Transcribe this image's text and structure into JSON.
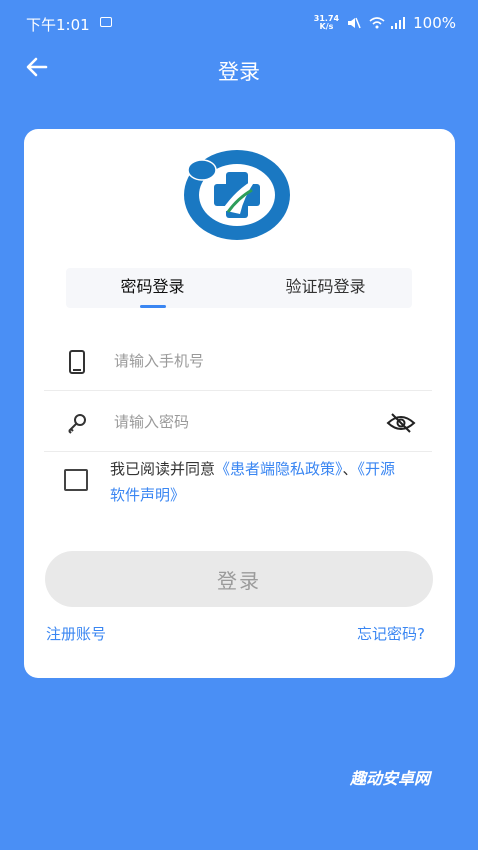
{
  "status_bar": {
    "time": "下午1:01",
    "speed_value": "31.74",
    "speed_unit": "K/s",
    "battery": "100%"
  },
  "header": {
    "title": "登录"
  },
  "tabs": [
    {
      "label": "密码登录",
      "active": true
    },
    {
      "label": "验证码登录",
      "active": false
    }
  ],
  "phone_field": {
    "placeholder": "请输入手机号",
    "value": ""
  },
  "password_field": {
    "placeholder": "请输入密码",
    "value": ""
  },
  "agreement": {
    "prefix": "我已阅读并同意",
    "privacy_link": "《患者端隐私政策》",
    "separator": "、",
    "opensource_link": "《开源软件声明》",
    "checked": false
  },
  "login_button": "登录",
  "register_link": "注册账号",
  "forgot_link": "忘记密码?",
  "watermark": "趣动安卓网",
  "colors": {
    "background": "#4a8ff5",
    "accent": "#3a86f2",
    "button_disabled": "#e9e9e9"
  }
}
